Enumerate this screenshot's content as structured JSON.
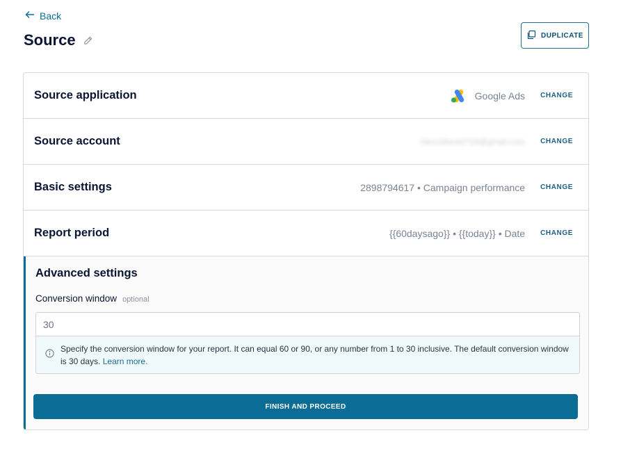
{
  "nav": {
    "back_label": "Back"
  },
  "header": {
    "title": "Source",
    "duplicate_label": "DUPLICATE"
  },
  "rows": [
    {
      "label": "Source application",
      "value": "Google Ads",
      "change": "CHANGE"
    },
    {
      "label": "Source account",
      "value": "hiexcellent4719@gmail.com",
      "change": "CHANGE"
    },
    {
      "label": "Basic settings",
      "value": "2898794617 • Campaign performance",
      "change": "CHANGE"
    },
    {
      "label": "Report period",
      "value": "{{60daysago}} • {{today}} • Date",
      "change": "CHANGE"
    }
  ],
  "advanced": {
    "title": "Advanced settings",
    "field_label": "Conversion window",
    "field_optional": "optional",
    "field_value": "30",
    "hint_text": "Specify the conversion window for your report. It can equal 60 or 90, or any number from 1 to 30 inclusive. The default conversion window is 30 days.",
    "hint_link": "Learn more.",
    "finish_label": "FINISH AND PROCEED"
  },
  "colors": {
    "accent": "#0b6d95",
    "border": "#d6d9de",
    "hint_bg": "#f0f9fc"
  }
}
